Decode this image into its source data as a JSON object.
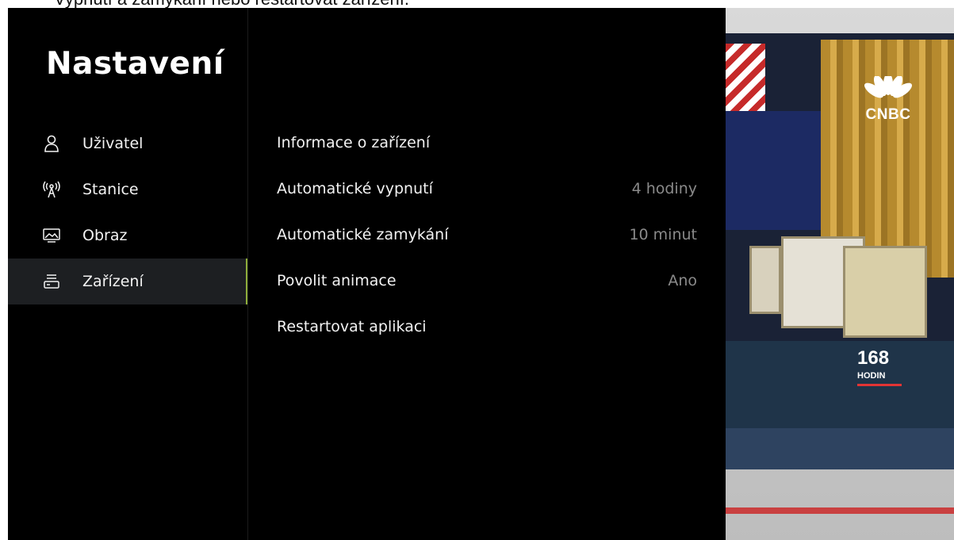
{
  "caption": "Vypnutí a zamykání nebo restartovat zařízení.",
  "settings": {
    "title": "Nastavení",
    "nav": [
      {
        "label": "Uživatel",
        "icon": "user-icon"
      },
      {
        "label": "Stanice",
        "icon": "antenna-icon"
      },
      {
        "label": "Obraz",
        "icon": "picture-icon"
      },
      {
        "label": "Zařízení",
        "icon": "device-icon",
        "active": true
      }
    ],
    "rows": [
      {
        "label": "Informace o zařízení",
        "value": ""
      },
      {
        "label": "Automatické vypnutí",
        "value": "4 hodiny"
      },
      {
        "label": "Automatické zamykání",
        "value": "10 minut"
      },
      {
        "label": "Povolit animace",
        "value": "Ano"
      },
      {
        "label": "Restartovat aplikaci",
        "value": ""
      }
    ]
  },
  "preview": {
    "channel_logo_text": "CNBC",
    "show_number": "168",
    "show_word": "HODIN"
  },
  "colors": {
    "accent": "#8fae3b",
    "background": "#000000",
    "active_bg": "#1d1f22",
    "value_text": "#8a8a8a"
  }
}
